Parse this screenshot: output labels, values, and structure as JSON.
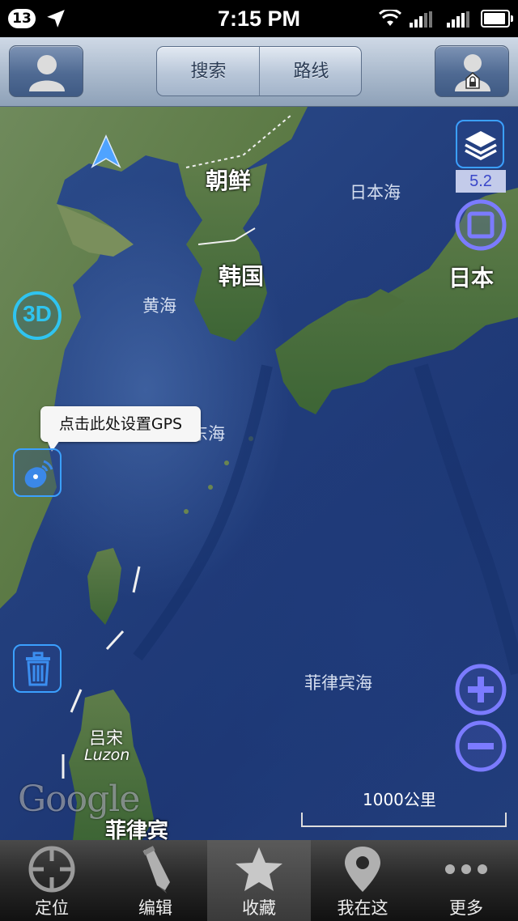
{
  "status_bar": {
    "notification_count": "13",
    "time": "7:15 PM",
    "icons": [
      "location-arrow-icon",
      "wifi-icon",
      "signal-icon",
      "signal-icon",
      "battery-icon"
    ]
  },
  "nav": {
    "left_icon": "user-avatar-icon",
    "right_icon": "user-lock-icon",
    "segments": [
      "搜索",
      "路线"
    ]
  },
  "map": {
    "labels": {
      "north_korea": "朝鲜",
      "south_korea": "韩国",
      "japan": "日本",
      "sea_of_japan": "日本海",
      "yellow_sea": "黄海",
      "east_sea_partial": "东海",
      "philippine_sea": "菲律宾海",
      "luzon_cn": "吕宋",
      "luzon_en": "Luzon",
      "philippines": "菲律宾"
    },
    "zoom_level": "5.2",
    "gps_tooltip": "点击此处设置GPS",
    "three_d_label": "3D",
    "google_logo": "Google",
    "scale_label": "1000公里",
    "controls": [
      "layers-icon",
      "full-screen-icon",
      "3d-toggle-icon",
      "gps-dish-icon",
      "trash-icon",
      "zoom-in-icon",
      "zoom-out-icon",
      "compass-arrow-icon"
    ]
  },
  "tabs": [
    {
      "label": "定位",
      "icon": "crosshair-icon"
    },
    {
      "label": "编辑",
      "icon": "pencil-icon"
    },
    {
      "label": "收藏",
      "icon": "star-icon"
    },
    {
      "label": "我在这",
      "icon": "map-pin-icon"
    },
    {
      "label": "更多",
      "icon": "more-dots-icon"
    }
  ]
}
